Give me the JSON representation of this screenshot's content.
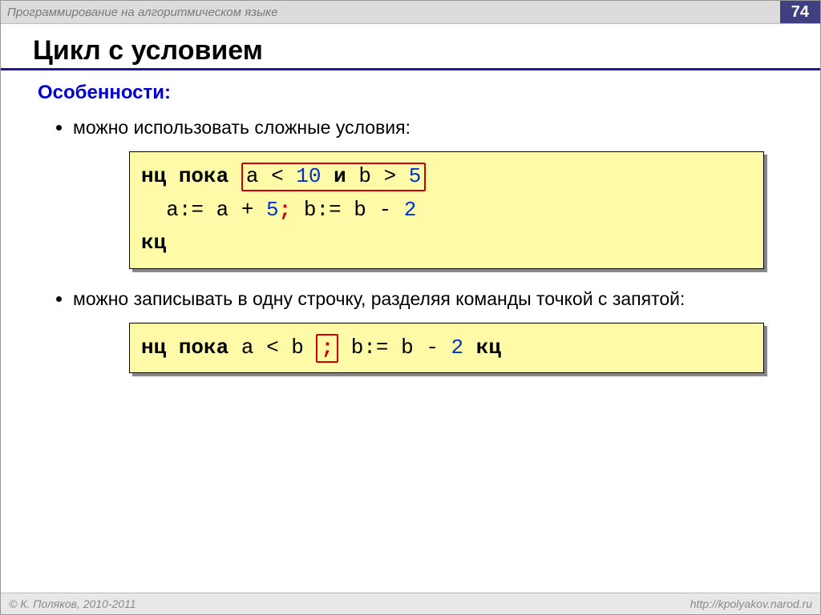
{
  "header": {
    "course_title": "Программирование на алгоритмическом языке",
    "page_number": "74"
  },
  "slide": {
    "title": "Цикл с условием",
    "section_label": "Особенности:",
    "bullets": [
      "можно использовать сложные условия:",
      "можно записывать в одну строчку, разделяя команды точкой с запятой:"
    ],
    "code1": {
      "kw_nc": "нц",
      "kw_while": "пока",
      "cond_a": "a",
      "cond_lt": "<",
      "cond_10": "10",
      "cond_and": "и",
      "cond_b": "b",
      "cond_gt": ">",
      "cond_5": "5",
      "body_a": "a:= a +",
      "body_5": "5",
      "body_semi": ";",
      "body_b": "b:= b -",
      "body_2": "2",
      "kw_kc": "кц"
    },
    "code2": {
      "kw_nc": "нц",
      "kw_while": "пока",
      "cond": "a < b",
      "semi": ";",
      "body": "b:= b -",
      "body_2": "2",
      "kw_kc": "кц"
    }
  },
  "footer": {
    "copyright": "© К. Поляков, 2010-2011",
    "url": "http://kpolyakov.narod.ru"
  }
}
